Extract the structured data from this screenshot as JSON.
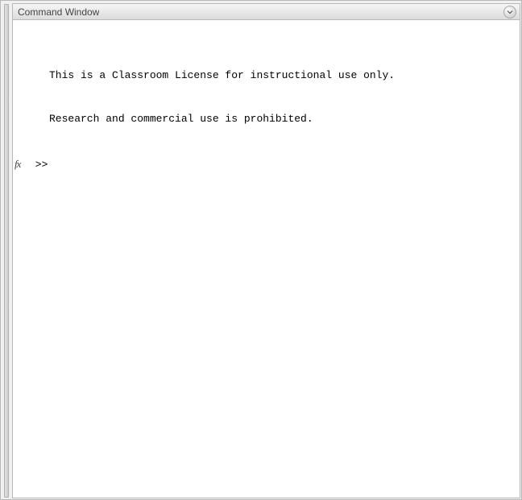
{
  "panel": {
    "title": "Command Window"
  },
  "console": {
    "messages": [
      "This is a Classroom License for instructional use only.",
      "Research and commercial use is prohibited."
    ],
    "fx_label": "fx",
    "prompt": " >> ",
    "input_value": ""
  }
}
